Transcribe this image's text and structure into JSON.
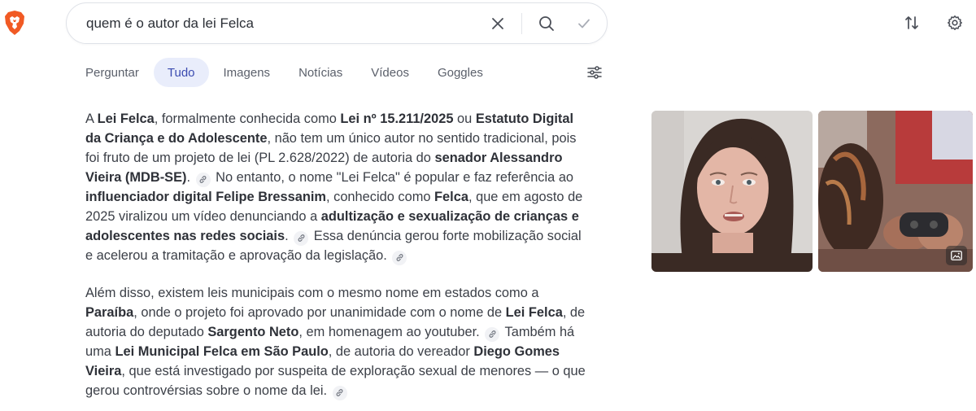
{
  "search": {
    "query": "quem é o autor da lei Felca"
  },
  "tabs": [
    {
      "label": "Perguntar",
      "active": false
    },
    {
      "label": "Tudo",
      "active": true
    },
    {
      "label": "Imagens",
      "active": false
    },
    {
      "label": "Notícias",
      "active": false
    },
    {
      "label": "Vídeos",
      "active": false
    },
    {
      "label": "Goggles",
      "active": false
    }
  ],
  "answer": {
    "p1": {
      "t1": "A ",
      "b1": "Lei Felca",
      "t2": ", formalmente conhecida como ",
      "b2": "Lei nº 15.211/2025",
      "t3": " ou ",
      "b3": "Estatuto Digital da Criança e do Adolescente",
      "t4": ", não tem um único autor no sentido tradicional, pois foi fruto de um projeto de lei (PL 2.628/2022) de autoria do ",
      "b4": "senador Alessandro Vieira (MDB-SE)",
      "t5": ".",
      "t6": " No entanto, o nome \"Lei Felca\" é popular e faz referência ao ",
      "b5": "influenciador digital Felipe Bressanim",
      "t7": ", conhecido como ",
      "b6": "Felca",
      "t8": ", que em agosto de 2025 viralizou um vídeo denunciando a ",
      "b7": "adultização e sexualização de crianças e adolescentes nas redes sociais",
      "t9": ".",
      "t10": " Essa denúncia gerou forte mobilização social e acelerou a tramitação e aprovação da legislação."
    },
    "p2": {
      "t1": "Além disso, existem leis municipais com o mesmo nome em estados como a ",
      "b1": "Paraíba",
      "t2": ", onde o projeto foi aprovado por unanimidade com o nome de ",
      "b2": "Lei Felca",
      "t3": ", de autoria do deputado ",
      "b3": "Sargento Neto",
      "t4": ", em homenagem ao youtuber.",
      "t5": " Também há uma ",
      "b4": "Lei Municipal Felca em São Paulo",
      "t6": ", de autoria do vereador ",
      "b5": "Diego Gomes Vieira",
      "t7": ", que está investigado por suspeita de exploração sexual de menores — o que gerou controvérsias sobre o nome da lei."
    }
  },
  "icons": {
    "logo": "brave-lion-logo",
    "clear": "close-icon",
    "search": "search-icon",
    "submit": "check-icon",
    "swap": "swap-icon",
    "settings": "gear-icon",
    "filters": "sliders-icon",
    "cite": "link-icon",
    "image_badge": "image-icon"
  },
  "colors": {
    "accent": "#3b4bb0",
    "active_tab_bg": "#e9edfb",
    "brand": "#f15a24"
  }
}
